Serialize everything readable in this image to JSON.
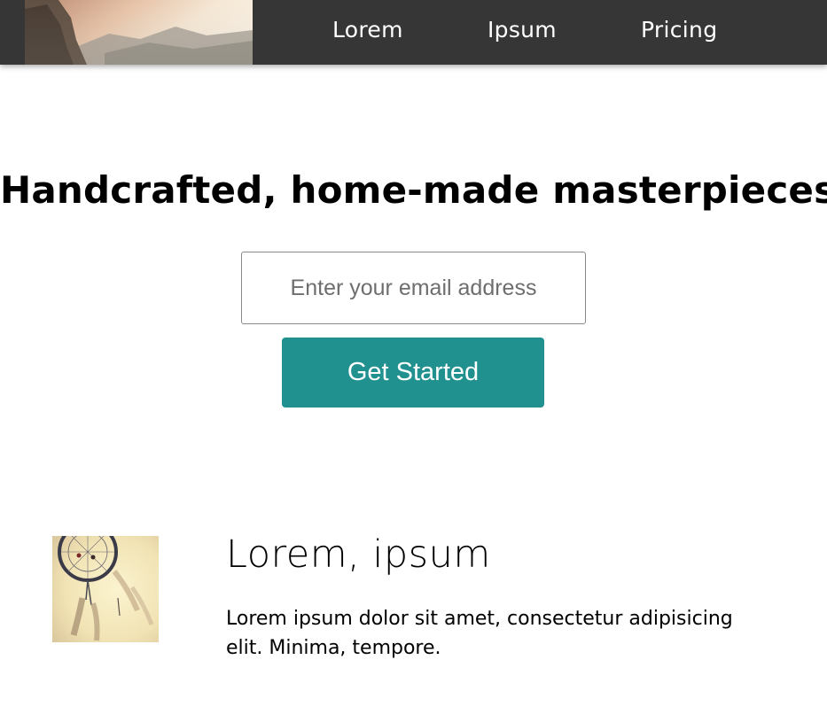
{
  "nav": {
    "items": [
      {
        "label": "Lorem"
      },
      {
        "label": "Ipsum"
      },
      {
        "label": "Pricing"
      }
    ]
  },
  "hero": {
    "title": "Handcrafted, home-made masterpieces",
    "email_placeholder": "Enter your email address",
    "cta_label": "Get Started"
  },
  "feature": {
    "title": "Lorem, ipsum",
    "text": "Lorem ipsum dolor sit amet, consectetur adipisicing elit. Minima, tempore.",
    "image_icon": "dreamcatcher-image"
  },
  "colors": {
    "header_bg": "#363636",
    "accent": "#20918f",
    "text": "#000000"
  }
}
